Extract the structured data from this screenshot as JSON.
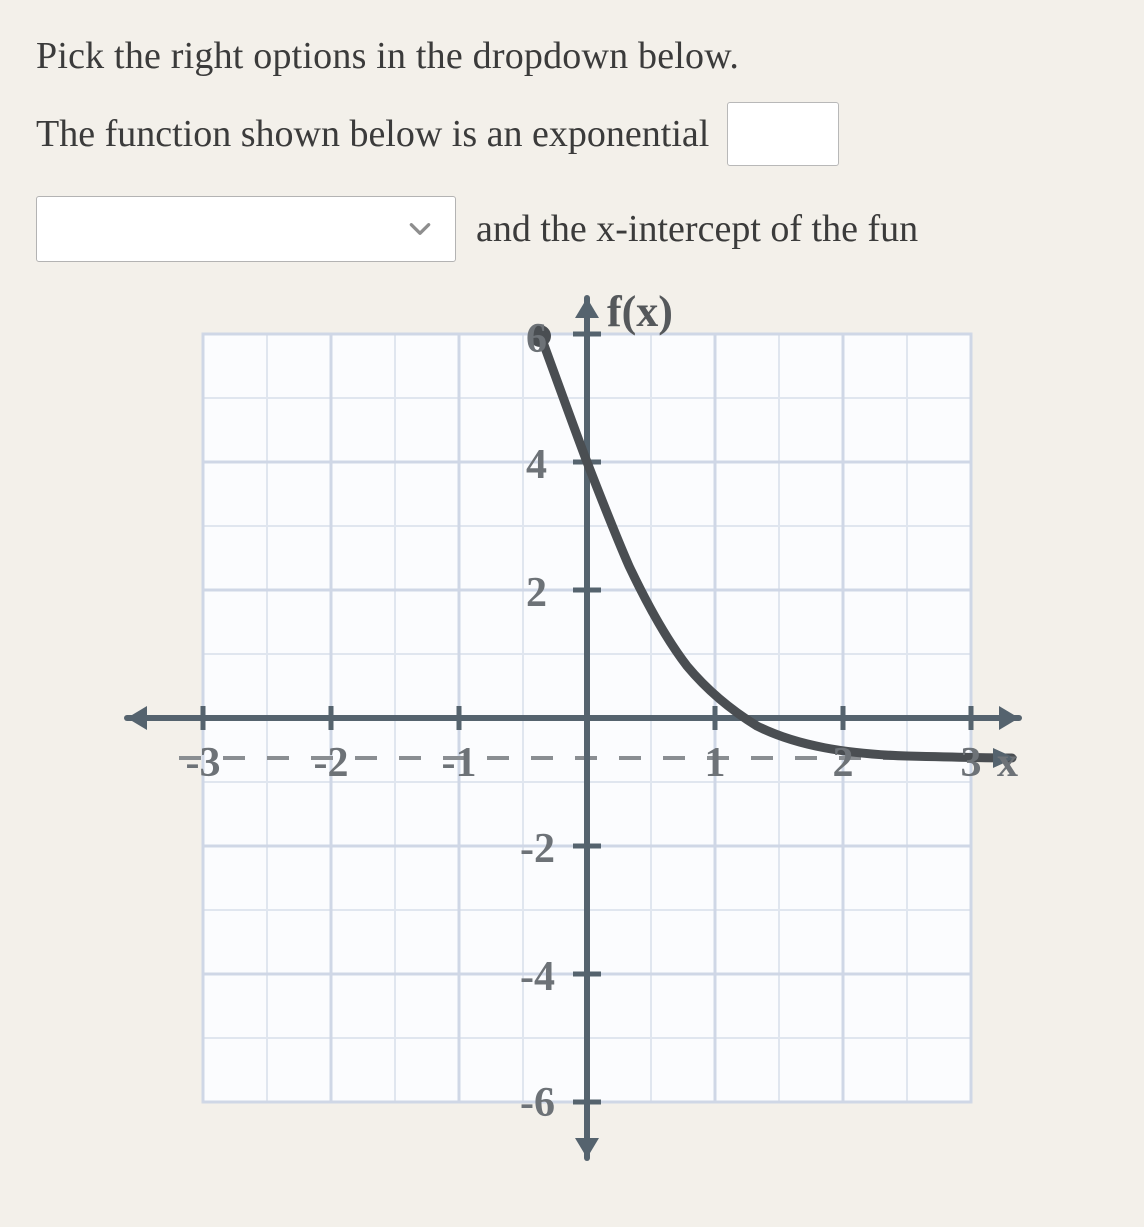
{
  "text": {
    "line1": "Pick the right options in the dropdown below.",
    "line2_prefix": "The function shown below is an exponential",
    "line3_suffix": "and the x-intercept of the fun"
  },
  "dropdown1": {
    "value": "",
    "placeholder": ""
  },
  "dropdown2": {
    "value": "",
    "placeholder": ""
  },
  "chart_data": {
    "type": "line",
    "title": "",
    "xlabel": "x",
    "ylabel": "f(x)",
    "xlim": [
      -3.5,
      3.5
    ],
    "ylim": [
      -6.5,
      6.5
    ],
    "x_ticks": [
      -3,
      -2,
      -1,
      1,
      2,
      3
    ],
    "y_ticks": [
      -6,
      -4,
      -2,
      2,
      4,
      6
    ],
    "asymptote_y": -1,
    "series": [
      {
        "name": "f(x)",
        "x": [
          -0.37,
          -0.25,
          0,
          0.25,
          0.5,
          1,
          1.5,
          2,
          2.5,
          3,
          3.3
        ],
        "y": [
          6,
          5,
          4,
          2.7,
          1.83,
          0.41,
          -0.41,
          -0.72,
          -0.87,
          -0.94,
          -0.97
        ]
      }
    ],
    "points_highlighted": [
      {
        "x": -0.37,
        "y": 6,
        "label": ""
      }
    ],
    "x_intercept_approx": 1.16,
    "y_intercept": 4
  },
  "labels": {
    "fx": "f(x)",
    "x": "x",
    "y2": "2",
    "y4": "4",
    "y6": "6",
    "ym2": "-2",
    "ym4": "-4",
    "ym6": "-6",
    "xm1": "-1",
    "xm2": "-2",
    "xm3": "-3",
    "x1": "1",
    "x2": "2",
    "x3": "3"
  }
}
